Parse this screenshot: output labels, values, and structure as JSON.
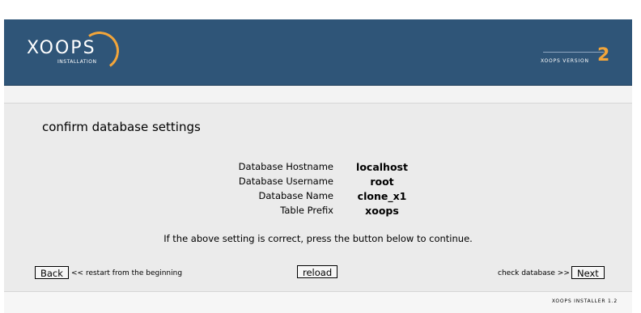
{
  "header": {
    "logo_text": "XOOPS",
    "logo_sub": "INSTALLATION",
    "version_label": "XOOPS VERSION",
    "version_number": "2"
  },
  "main": {
    "title": "confirm database settings",
    "settings": [
      {
        "label": "Database Hostname",
        "value": "localhost"
      },
      {
        "label": "Database Username",
        "value": "root"
      },
      {
        "label": "Database Name",
        "value": "clone_x1"
      },
      {
        "label": "Table Prefix",
        "value": "xoops"
      }
    ],
    "note": "If the above setting is correct, press the button below to continue."
  },
  "nav": {
    "back_label": "Back",
    "back_hint": "<< restart from the beginning",
    "reload_label": "reload",
    "next_hint": "check database >>",
    "next_label": "Next"
  },
  "footer": {
    "text": "XOOPS INSTALLER 1.2"
  },
  "colors": {
    "header_bg": "#2f5578",
    "accent": "#f2a53a",
    "page_bg": "#ebebeb"
  }
}
